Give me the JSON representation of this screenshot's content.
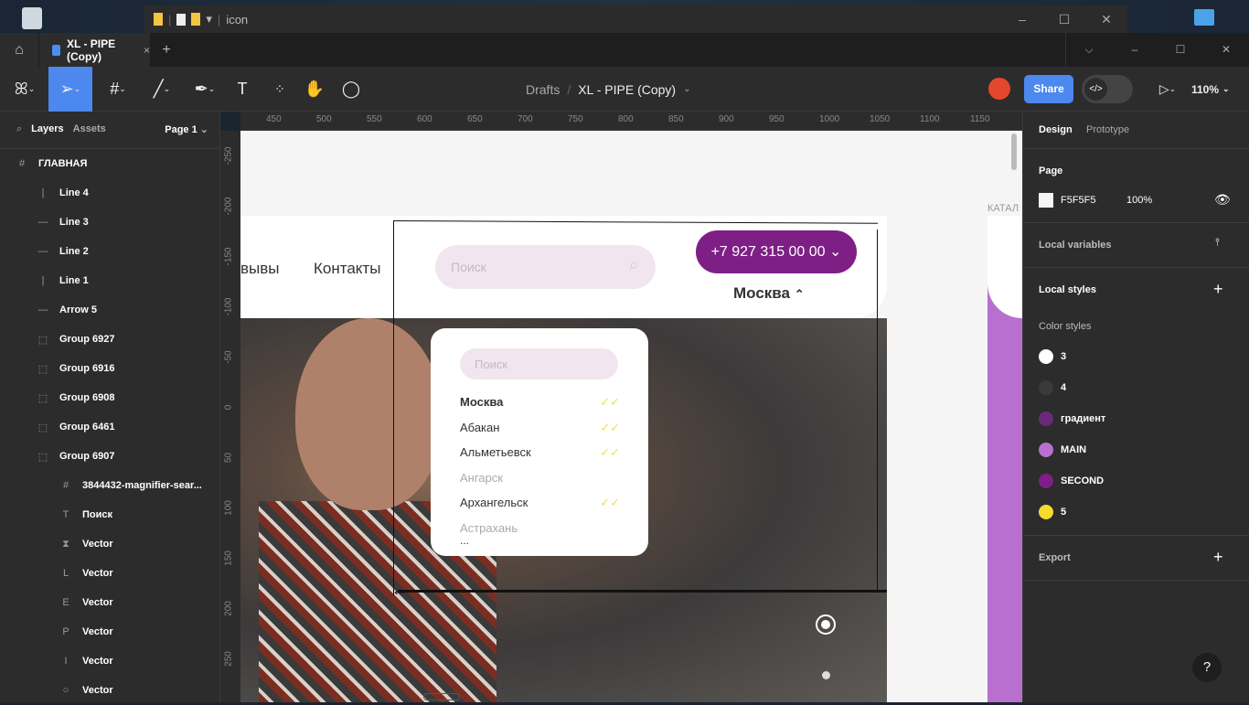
{
  "explorer": {
    "title": "icon",
    "window_buttons": [
      "–",
      "☐",
      "✕"
    ]
  },
  "tabbar": {
    "file_tab": "XL - PIPE (Copy)",
    "close": "×",
    "new_tab": "+",
    "window_buttons": [
      "⌵",
      "–",
      "☐",
      "✕"
    ]
  },
  "toolbar": {
    "breadcrumb_root": "Drafts",
    "separator": "/",
    "file_name": "XL - PIPE (Copy)",
    "share": "Share",
    "zoom": "110%",
    "active_tool": "move"
  },
  "left_panel": {
    "tabs": [
      "Layers",
      "Assets"
    ],
    "page": "Page 1",
    "layers": [
      {
        "name": "ГЛАВНАЯ",
        "icon": "#",
        "depth": 0
      },
      {
        "name": "Line 4",
        "icon": "|",
        "depth": 1
      },
      {
        "name": "Line 3",
        "icon": "—",
        "depth": 1
      },
      {
        "name": "Line 2",
        "icon": "—",
        "depth": 1
      },
      {
        "name": "Line 1",
        "icon": "|",
        "depth": 1
      },
      {
        "name": "Arrow 5",
        "icon": "—",
        "depth": 1
      },
      {
        "name": "Group 6927",
        "icon": "⬚",
        "depth": 1
      },
      {
        "name": "Group 6916",
        "icon": "⬚",
        "depth": 1
      },
      {
        "name": "Group 6908",
        "icon": "⬚",
        "depth": 1
      },
      {
        "name": "Group 6461",
        "icon": "⬚",
        "depth": 1
      },
      {
        "name": "Group 6907",
        "icon": "⬚",
        "depth": 1
      },
      {
        "name": "3844432-magnifier-sear...",
        "icon": "#",
        "depth": 2
      },
      {
        "name": "Поиск",
        "icon": "T",
        "depth": 2
      },
      {
        "name": "Vector",
        "icon": "⧗",
        "depth": 2
      },
      {
        "name": "Vector",
        "icon": "L",
        "depth": 2
      },
      {
        "name": "Vector",
        "icon": "E",
        "depth": 2
      },
      {
        "name": "Vector",
        "icon": "P",
        "depth": 2
      },
      {
        "name": "Vector",
        "icon": "I",
        "depth": 2
      },
      {
        "name": "Vector",
        "icon": "○",
        "depth": 2
      }
    ]
  },
  "rulers": {
    "h": [
      "450",
      "500",
      "550",
      "600",
      "650",
      "700",
      "750",
      "800",
      "850",
      "900",
      "950",
      "1000",
      "1050",
      "1100",
      "1150"
    ],
    "v": [
      "-250",
      "-200",
      "-150",
      "-100",
      "-50",
      "0",
      "50",
      "100",
      "150",
      "200",
      "250"
    ]
  },
  "canvas": {
    "nav": [
      "вывы",
      "Контакты"
    ],
    "search_placeholder": "Поиск",
    "phone": "+7 927 315 00 00",
    "city": "Москва",
    "side_label": "КАТАЛ",
    "dropdown": {
      "search_placeholder": "Поиск",
      "cities": [
        {
          "name": "Москва",
          "checked": true,
          "bold": true
        },
        {
          "name": "Абакан",
          "checked": true
        },
        {
          "name": "Альметьевск",
          "checked": true
        },
        {
          "name": "Ангарск",
          "checked": false
        },
        {
          "name": "Архангельск",
          "checked": true
        },
        {
          "name": "Астрахань",
          "checked": false
        }
      ],
      "more": "..."
    }
  },
  "right_panel": {
    "tabs": [
      "Design",
      "Prototype"
    ],
    "page_title": "Page",
    "page_color": "F5F5F5",
    "page_opacity": "100%",
    "local_variables": "Local variables",
    "local_styles": "Local styles",
    "color_styles_title": "Color styles",
    "color_styles": [
      {
        "name": "3",
        "color": "#ffffff"
      },
      {
        "name": "4",
        "color": "#3a3a3a"
      },
      {
        "name": "градиент",
        "color": "#6a2a7a"
      },
      {
        "name": "MAIN",
        "color": "#b96fd0"
      },
      {
        "name": "SECOND",
        "color": "#7e1f86"
      },
      {
        "name": "5",
        "color": "#f5dc2a"
      }
    ],
    "export": "Export",
    "help": "?"
  }
}
